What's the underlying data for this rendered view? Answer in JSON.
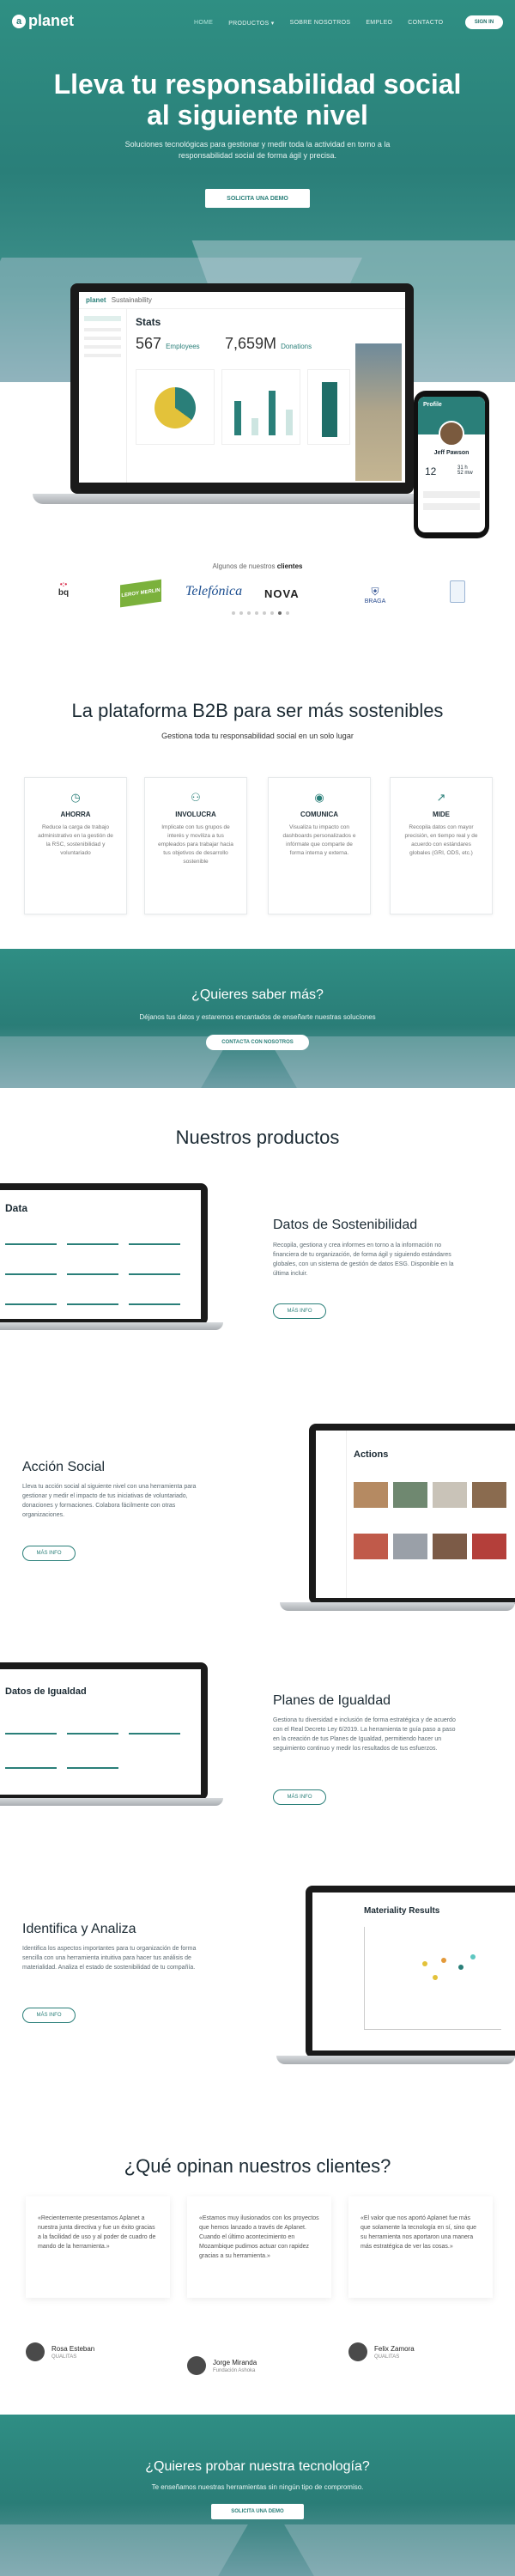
{
  "nav": {
    "brand": "planet",
    "links": [
      "HOME",
      "PRODUCTOS",
      "SOBRE NOSOTROS",
      "EMPLEO",
      "CONTACTO"
    ],
    "sign_in": "SIGN IN"
  },
  "hero": {
    "title_line1": "Lleva tu responsabilidad social",
    "title_line2": "al siguiente nivel",
    "subtitle": "Soluciones tecnológicas para gestionar y medir toda la actividad en torno a la responsabilidad social de forma ágil y precisa.",
    "cta": "SOLICITA UNA DEMO"
  },
  "mockup": {
    "brand": "planet",
    "app_name": "Sustainability",
    "page_title": "Stats",
    "stat1_value": "567",
    "stat1_label": "Employees",
    "stat2_value": "7,659M",
    "stat2_label": "Donations",
    "phone_title": "Profile",
    "phone_name": "Jeff Pawson",
    "phone_stat1": "12",
    "phone_stat2": "31 h",
    "phone_stat3": "52 mw"
  },
  "clients": {
    "label_prefix": "Algunos de nuestros ",
    "label_bold": "clientes",
    "logos": [
      "bq",
      "LEROY MERLIN",
      "Telefónica",
      "NOVA",
      "BRAGA",
      ""
    ]
  },
  "platform": {
    "title": "La plataforma B2B para ser más sostenibles",
    "subtitle": "Gestiona toda tu responsabilidad social en un solo lugar",
    "features": [
      {
        "icon": "clock-icon",
        "title": "AHORRA",
        "desc": "Reduce la carga de trabajo administrativo en la gestión de la RSC, sostenibilidad y voluntariado"
      },
      {
        "icon": "handshake-icon",
        "title": "INVOLUCRA",
        "desc": "Implicate con tus grupos de interés y moviliza a tus empleados para trabajar hacia tus objetivos de desarrollo sostenible"
      },
      {
        "icon": "eye-icon",
        "title": "COMUNICA",
        "desc": "Visualiza tu impacto con dashboards personalizados e infórmate que comparte de forma interna y externa."
      },
      {
        "icon": "trend-icon",
        "title": "MIDE",
        "desc": "Recopila datos con mayor precisión, en tiempo real y de acuerdo con estándares globales (GRI, ODS, etc.)"
      }
    ]
  },
  "cta_band": {
    "title": "¿Quieres saber más?",
    "subtitle": "Déjanos tus datos y estaremos encantados de enseñarte nuestras soluciones",
    "button": "CONTACTA CON NOSOTROS"
  },
  "products": {
    "title": "Nuestros productos",
    "items": [
      {
        "title": "Datos de Sostenibilidad",
        "desc": "Recopila, gestiona y crea informes en torno a la información no financiera de tu organización, de forma ágil y siguiendo estándares globales, con un sistema de gestión de datos ESG. Disponible en la última incluir.",
        "button": "MÁS INFO"
      },
      {
        "title": "Acción Social",
        "desc": "Lleva tu acción social al siguiente nivel con una herramienta para gestionar y medir el impacto de tus iniciativas de voluntariado, donaciones y formaciones. Colabora fácilmente con otras organizaciones.",
        "button": "MÁS INFO"
      },
      {
        "title": "Planes de Igualdad",
        "desc": "Gestiona tu diversidad e inclusión de forma estratégica y de acuerdo con el Real Decreto Ley 6/2019. La herramienta te guía paso a paso en la creación de tus Planes de Igualdad, permitiendo hacer un seguimiento continuo y medir los resultados de tus esfuerzos.",
        "button": "MÁS INFO"
      },
      {
        "title": "Identifica y Analiza",
        "desc": "Identifica los aspectos importantes para tu organización de forma sencilla con una herramienta intuitiva para hacer tus análisis de materialidad. Analiza el estado de sostenibilidad de tu compañía.",
        "button": "MÁS INFO"
      }
    ],
    "screens": {
      "s1_title": "Data",
      "s2_title": "Actions",
      "s3_title": "Datos de Igualdad",
      "s4_title": "Materiality Results"
    }
  },
  "testimonials": {
    "title": "¿Qué opinan nuestros clientes?",
    "items": [
      {
        "quote": "«Recientemente presentamos Aplanet a nuestra junta directiva y fue un éxito gracias a la facilidad de uso y al poder de cuadro de mando de la herramienta.»",
        "name": "Rosa Esteban",
        "role": "QUALITAS"
      },
      {
        "quote": "«Estamos muy ilusionados con los proyectos que hemos lanzado a través de Aplanet. Cuando el último acontecimiento en Mozambique pudimos actuar con rapidez gracias a su herramienta.»",
        "name": "Jorge Miranda",
        "role": "Fundación Ashoka"
      },
      {
        "quote": "«El valor que nos aportó Aplanet fue más que solamente la tecnología en sí, sino que su herramienta nos aportaron una manera más estratégica de ver las cosas.»",
        "name": "Felix Zamora",
        "role": "QUALITAS"
      }
    ]
  },
  "footer_cta": {
    "title": "¿Quieres probar nuestra tecnología?",
    "subtitle": "Te enseñamos nuestras herramientas sin ningún tipo de compromiso.",
    "button": "SOLICITA UNA DEMO"
  },
  "colors": {
    "brand": "#2a7f79",
    "accent": "#16a085"
  }
}
